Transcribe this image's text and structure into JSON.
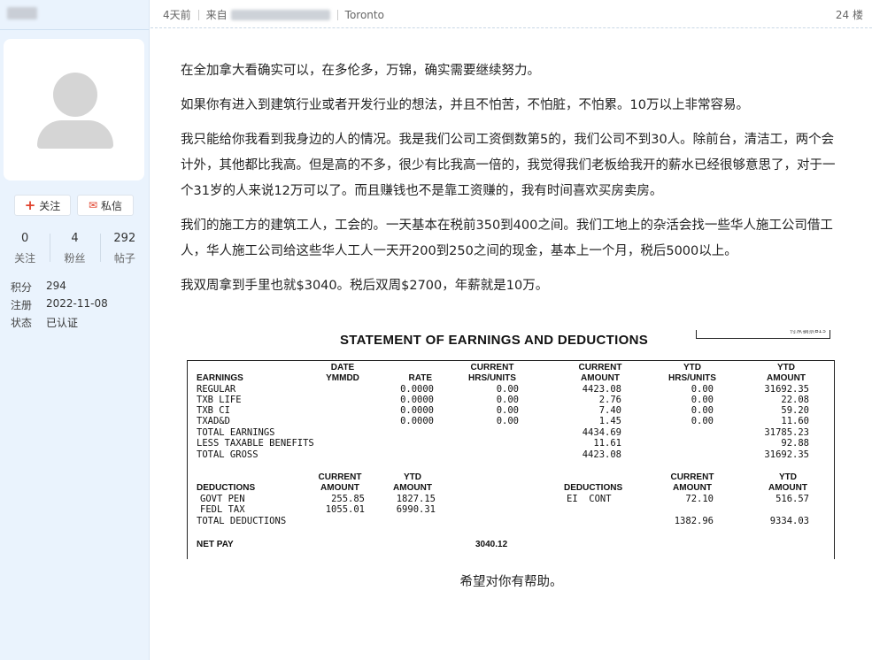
{
  "sidebar": {
    "follow_label": "关注",
    "message_label": "私信",
    "stats": [
      {
        "num": "0",
        "label": "关注"
      },
      {
        "num": "4",
        "label": "粉丝"
      },
      {
        "num": "292",
        "label": "帖子"
      }
    ],
    "info": [
      {
        "key": "积分",
        "value": "294"
      },
      {
        "key": "注册",
        "value": "2022-11-08"
      },
      {
        "key": "状态",
        "value": "已认证"
      }
    ]
  },
  "post": {
    "time": "4天前",
    "from_label": "来自",
    "location": "Toronto",
    "floor": "24 楼",
    "paragraphs": [
      "在全加拿大看确实可以，在多伦多，万锦，确实需要继续努力。",
      "如果你有进入到建筑行业或者开发行业的想法，并且不怕苦，不怕脏，不怕累。10万以上非常容易。",
      "我只能给你我看到我身边的人的情况。我是我们公司工资倒数第5的，我们公司不到30人。除前台，清洁工，两个会计外，其他都比我高。但是高的不多，很少有比我高一倍的，我觉得我们老板给我开的薪水已经很够意思了，对于一个31岁的人来说12万可以了。而且赚钱也不是靠工资赚的，我有时间喜欢买房卖房。",
      "我们的施工方的建筑工人，工会的。一天基本在税前350到400之间。我们工地上的杂活会找一些华人施工公司借工人，华人施工公司给这些华人工人一天开200到250之间的现金，基本上一个月，税后5000以上。",
      "我双周拿到手里也就$3040。税后双周$2700，年薪就是10万。"
    ],
    "closing": "希望对你有帮助。"
  },
  "statement": {
    "title": "STATEMENT OF EARNINGS AND DEDUCTIONS",
    "corner_text": "付从钢票BIS",
    "headers": {
      "date": "DATE",
      "yymmdd": "YMMDD",
      "earnings": "EARNINGS",
      "rate": "RATE",
      "current": "CURRENT",
      "hrs_units": "HRS/UNITS",
      "current2": "CURRENT",
      "amount": "AMOUNT",
      "ytd": "YTD",
      "hrs_units2": "HRS/UNITS",
      "ytd2": "YTD",
      "amount2": "AMOUNT"
    },
    "earnings_rows": [
      {
        "name": "REGULAR",
        "rate": "0.0000",
        "hrs": "0.00",
        "amount": "4423.08",
        "ytd_hrs": "0.00",
        "ytd_amount": "31692.35"
      },
      {
        "name": "TXB LIFE",
        "rate": "0.0000",
        "hrs": "0.00",
        "amount": "2.76",
        "ytd_hrs": "0.00",
        "ytd_amount": "22.08"
      },
      {
        "name": "TXB CI",
        "rate": "0.0000",
        "hrs": "0.00",
        "amount": "7.40",
        "ytd_hrs": "0.00",
        "ytd_amount": "59.20"
      },
      {
        "name": "TXAD&D",
        "rate": "0.0000",
        "hrs": "0.00",
        "amount": "1.45",
        "ytd_hrs": "0.00",
        "ytd_amount": "11.60"
      }
    ],
    "totals": [
      {
        "name": "TOTAL EARNINGS",
        "amount": "4434.69",
        "ytd_amount": "31785.23"
      },
      {
        "name": "LESS TAXABLE BENEFITS",
        "amount": "11.61",
        "ytd_amount": "92.88"
      },
      {
        "name": "TOTAL GROSS",
        "amount": "4423.08",
        "ytd_amount": "31692.35"
      }
    ],
    "ded_headers": {
      "deductions": "DEDUCTIONS",
      "current": "CURRENT",
      "amount": "AMOUNT",
      "ytd": "YTD",
      "amount_ytd": "AMOUNT"
    },
    "deductions_left": [
      {
        "name": "GOVT PEN",
        "current": "255.85",
        "ytd": "1827.15"
      },
      {
        "name": "FEDL TAX",
        "current": "1055.01",
        "ytd": "6990.31"
      }
    ],
    "deductions_right": [
      {
        "name": "EI  CONT",
        "current": "72.10",
        "ytd": "516.57"
      }
    ],
    "total_deductions": {
      "name": "TOTAL DEDUCTIONS",
      "current": "1382.96",
      "ytd": "9334.03"
    },
    "net_pay": {
      "label": "NET PAY",
      "value": "3040.12"
    }
  }
}
